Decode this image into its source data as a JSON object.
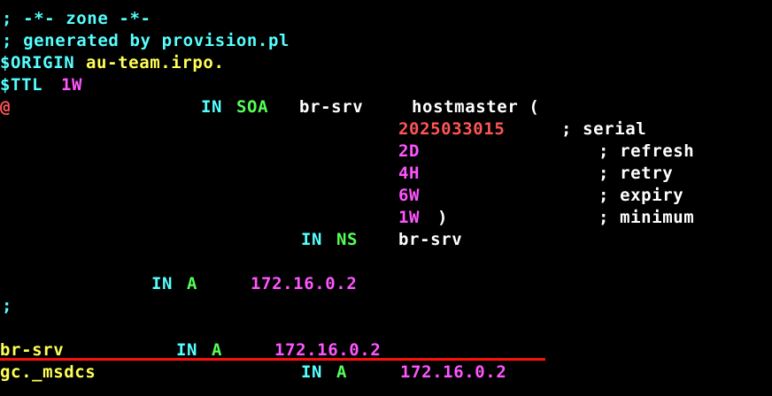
{
  "colors": {
    "background": "#000000",
    "comment": "#55ffff",
    "directive": "#55ffff",
    "value_yellow": "#ffff55",
    "keyword_green": "#55ff55",
    "name_white": "#ffffff",
    "address_magenta": "#ff55ff",
    "serial_red": "#ff5555",
    "annotation_red": "#ff1010"
  },
  "lines": {
    "comment_zone": "; -*- zone -*-",
    "comment_generated": "; generated by provision.pl",
    "origin_directive": "$ORIGIN",
    "origin_value": "au-team.irpo.",
    "ttl_directive": "$TTL",
    "ttl_value": "1W",
    "soa_at": "@",
    "soa_in": "IN",
    "soa_type": "SOA",
    "soa_primary": "br-srv",
    "soa_contact": "hostmaster (",
    "serial_value": "2025033015",
    "serial_comment": "; serial",
    "refresh_value": "2D",
    "refresh_comment": "; refresh",
    "retry_value": "4H",
    "retry_comment": "; retry",
    "expiry_value": "6W",
    "expiry_comment": "; expiry",
    "minimum_value": "1W",
    "minimum_paren": ")",
    "minimum_comment": "; minimum",
    "ns_in": "IN",
    "ns_type": "NS",
    "ns_value": "br-srv",
    "apex_in": "IN",
    "apex_type": "A",
    "apex_address": "172.16.0.2",
    "separator_comment": ";",
    "host1_name": "br-srv",
    "host1_in": "IN",
    "host1_type": "A",
    "host1_address": "172.16.0.2",
    "host2_name": "gc._msdcs",
    "host2_in": "IN",
    "host2_type": "A",
    "host2_address": "172.16.0.2"
  }
}
